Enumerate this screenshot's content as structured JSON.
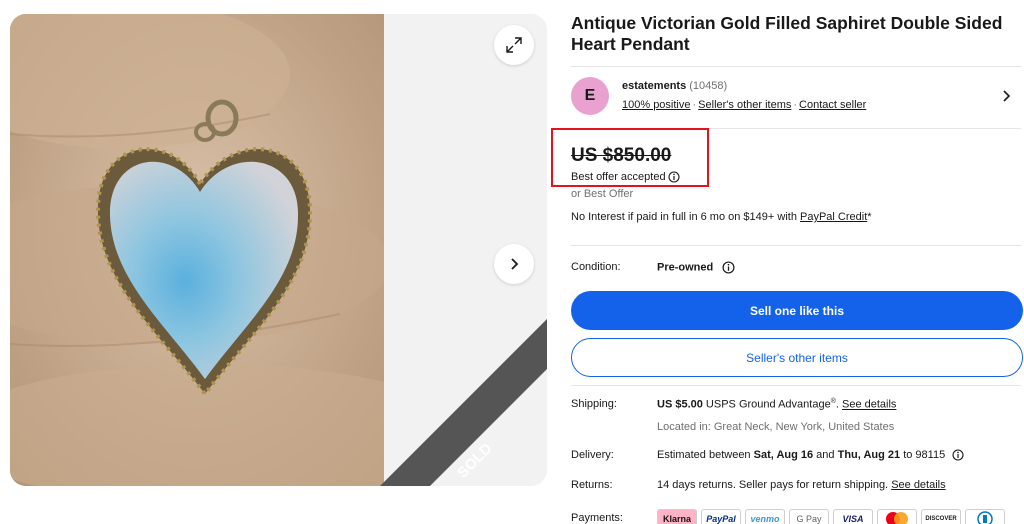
{
  "listing": {
    "title": "Antique Victorian Gold Filled Saphiret Double Sided Heart Pendant",
    "sold_ribbon": "SOLD"
  },
  "seller": {
    "avatar_letter": "E",
    "name": "estatements",
    "feedback_count": "(10458)",
    "positive": "100% positive",
    "other_items": "Seller's other items",
    "contact": "Contact seller"
  },
  "price": {
    "amount": "US $850.00",
    "best_offer_accepted": "Best offer accepted",
    "or_best_offer": "or Best Offer",
    "financing_text": "No Interest if paid in full in 6 mo on $149+ with ",
    "financing_link": "PayPal Credit",
    "financing_suffix": "*"
  },
  "condition": {
    "label": "Condition:",
    "value": "Pre-owned"
  },
  "buttons": {
    "sell_one": "Sell one like this",
    "other_items": "Seller's other items"
  },
  "shipping": {
    "label": "Shipping:",
    "price": "US $5.00",
    "service": " USPS Ground Advantage",
    "reg": "®",
    "sep": ". ",
    "details_link": "See details",
    "location": "Located in: Great Neck, New York, United States"
  },
  "delivery": {
    "label": "Delivery:",
    "prefix": "Estimated between ",
    "start": "Sat, Aug 16",
    "and": " and ",
    "end": "Thu, Aug 21",
    "suffix": " to 98115"
  },
  "returns": {
    "label": "Returns:",
    "text": "14 days returns. Seller pays for return shipping. ",
    "details_link": "See details"
  },
  "payments": {
    "label": "Payments:",
    "methods": [
      "Klarna",
      "PayPal",
      "venmo",
      "G Pay",
      "VISA",
      "",
      "DISCOVER",
      ""
    ]
  },
  "icons": {
    "expand": "expand-icon",
    "next": "chevron-right-icon",
    "seller_chevron": "chevron-right-icon",
    "info": "info-icon"
  },
  "colors": {
    "primary_blue": "#1462e9",
    "highlight_red": "#e0141d",
    "avatar_pink": "#e9a2d0"
  }
}
